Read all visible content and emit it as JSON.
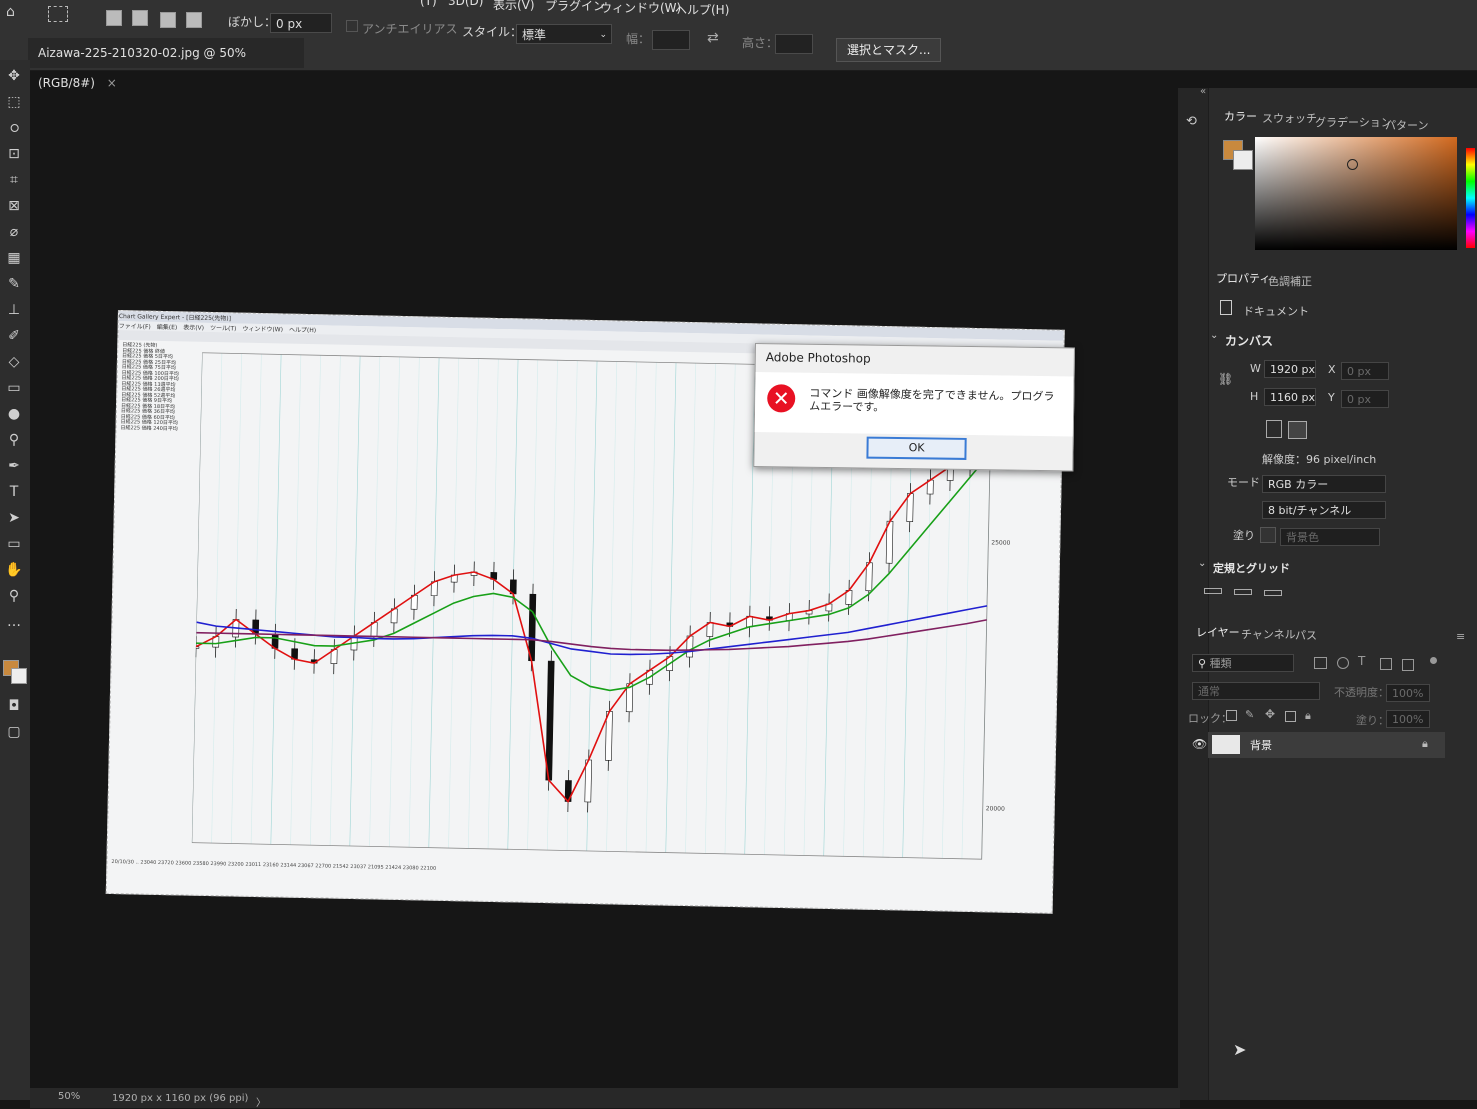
{
  "menu": {
    "items": [
      "(T)",
      "3D(D)",
      "表示(V)",
      "プラグイン",
      "ウィンドウ(W)",
      "ヘルプ(H)"
    ]
  },
  "options": {
    "feather_label": "ぼかし：",
    "feather_value": "0 px",
    "antialias_label": "アンチエイリアス",
    "style_label": "スタイル：",
    "style_value": "標準",
    "width_label": "幅：",
    "height_label": "高さ：",
    "select_mask_label": "選択とマスク..."
  },
  "document": {
    "tab_title": "Aizawa-225-210320-02.jpg @ 50% (RGB/8#)",
    "close_symbol": "×"
  },
  "canvas_image": {
    "window_title": "Chart Gallery Expert - [日経225(先物)]",
    "window_menu": "ファイル(F)　編集(E)　表示(V)　ツール(T)　ウィンドウ(W)　ヘルプ(H)",
    "legend": [
      "日経225 (先物)",
      "日経225 価格 終値",
      "日経225 価格 5日平均",
      "日経225 価格 25日平均",
      "日経225 価格 75日平均",
      "日経225 価格 100日平均",
      "日経225 価格 200日平均",
      "日経225 価格 13週平均",
      "日経225 価格 26週平均",
      "日経225 価格 52週平均",
      "日経225 価格 9日平均",
      "日経225 価格 18日平均",
      "日経225 価格 36日平均",
      "日経225 価格 60日平均",
      "日経225 価格 120日平均",
      "日経225 価格 240日平均"
    ],
    "y_labels": [
      "25000",
      "20000"
    ],
    "x_axis_text": "20/10/30 ‥ 23040 23720 23600 23580 23990 23200 23011 23160 23144 23067 22700 21542 23037 21095 21424 23080 22100"
  },
  "dialog": {
    "title": "Adobe Photoshop",
    "message": "コマンド 画像解像度を完了できません。プログラムエラーです。",
    "ok_label": "OK",
    "icon": "error-icon"
  },
  "panels": {
    "color_tabs": [
      "カラー",
      "スウォッチ",
      "グラデーション",
      "パターン"
    ],
    "props_tabs": [
      "プロパティ",
      "色調補正"
    ],
    "doc_label": "ドキュメント",
    "canvas_header": "カンバス",
    "w_label": "W",
    "w_value": "1920 px",
    "h_label": "H",
    "h_value": "1160 px",
    "x_label": "X",
    "x_value": "0 px",
    "y_label": "Y",
    "y_value": "0 px",
    "resolution": "解像度：96 pixel/inch",
    "mode_label": "モード",
    "mode_value": "RGB カラー",
    "depth_value": "8 bit/チャンネル",
    "fill_label": "塗り",
    "fill_value": "背景色",
    "rulers_header": "定規とグリッド",
    "layer_tabs": [
      "レイヤー",
      "チャンネル",
      "パス"
    ],
    "layer_search": "種類",
    "blend_mode": "通常",
    "opacity_label": "不透明度：",
    "opacity_value": "100%",
    "lock_label": "ロック：",
    "fill2_label": "塗り：",
    "fill2_value": "100%",
    "layer_name": "背景"
  },
  "status": {
    "zoom": "50%",
    "doc_size": "1920 px x 1160 px (96 ppi)",
    "arrow": "〉"
  },
  "colors": {
    "foreground": "#c8893e",
    "background": "#ededed",
    "accent": "#3a7bd5",
    "error": "#e81123"
  },
  "chart_data": {
    "type": "line",
    "yticks": [
      "25000",
      "20000"
    ],
    "series": [
      {
        "color": "#e01010",
        "values": [
          23300,
          23450,
          23700,
          23500,
          23300,
          23150,
          23100,
          23300,
          23500,
          23700,
          23900,
          24100,
          24300,
          24400,
          24450,
          24350,
          24150,
          23200,
          21500,
          21200,
          21800,
          22500,
          22900,
          23100,
          23300,
          23600,
          23800,
          23750,
          23900,
          23850,
          23950,
          24000,
          24100,
          24300,
          24700,
          25300,
          25700,
          25900,
          26100,
          26500,
          27000
        ]
      },
      {
        "color": "#18a018",
        "values": [
          23350,
          23350,
          23400,
          23450,
          23450,
          23400,
          23350,
          23350,
          23400,
          23450,
          23550,
          23700,
          23850,
          24000,
          24100,
          24150,
          24100,
          23900,
          23400,
          23000,
          22850,
          22800,
          22850,
          23000,
          23200,
          23400,
          23550,
          23650,
          23750,
          23800,
          23850,
          23900,
          23950,
          24050,
          24250,
          24550,
          24900,
          25250,
          25600,
          25950,
          26300
        ]
      },
      {
        "color": "#2020d0",
        "values": [
          23650,
          23600,
          23580,
          23560,
          23540,
          23520,
          23500,
          23480,
          23480,
          23470,
          23470,
          23480,
          23500,
          23520,
          23540,
          23550,
          23550,
          23520,
          23450,
          23380,
          23350,
          23320,
          23320,
          23330,
          23350,
          23380,
          23420,
          23460,
          23500,
          23540,
          23580,
          23620,
          23660,
          23700,
          23760,
          23820,
          23880,
          23940,
          24000,
          24060,
          24120
        ]
      },
      {
        "color": "#802060",
        "values": [
          23500,
          23500,
          23500,
          23500,
          23500,
          23500,
          23500,
          23500,
          23500,
          23500,
          23500,
          23500,
          23500,
          23500,
          23500,
          23500,
          23500,
          23500,
          23480,
          23450,
          23420,
          23400,
          23390,
          23390,
          23390,
          23400,
          23410,
          23420,
          23440,
          23460,
          23480,
          23510,
          23540,
          23570,
          23610,
          23660,
          23710,
          23760,
          23810,
          23860,
          23920
        ]
      }
    ]
  }
}
